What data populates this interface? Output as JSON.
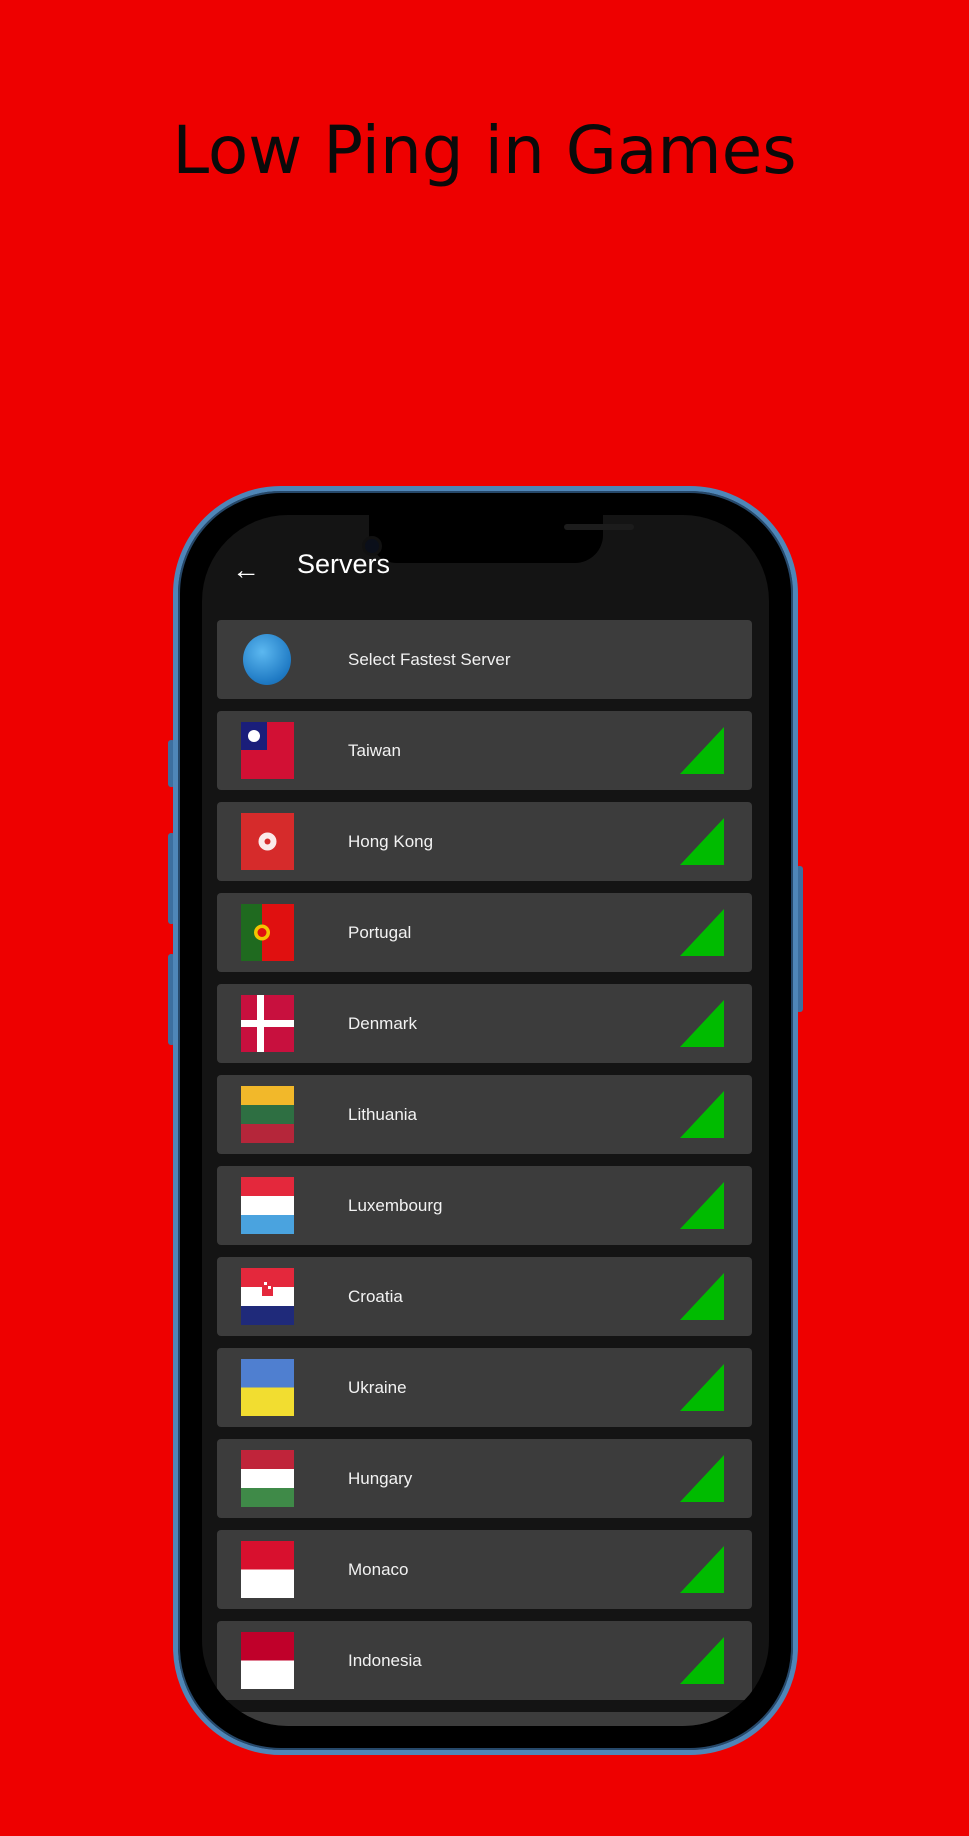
{
  "headline": "Low Ping in Games",
  "screen": {
    "title": "Servers",
    "back_icon": "arrow-left-icon",
    "fastest": {
      "label": "Select Fastest Server",
      "icon": "globe-icon"
    },
    "servers": [
      {
        "name": "Taiwan",
        "flag": "taiwan"
      },
      {
        "name": "Hong Kong",
        "flag": "hongkong"
      },
      {
        "name": "Portugal",
        "flag": "portugal"
      },
      {
        "name": "Denmark",
        "flag": "denmark"
      },
      {
        "name": "Lithuania",
        "flag": "lithuania"
      },
      {
        "name": "Luxembourg",
        "flag": "luxembourg"
      },
      {
        "name": "Croatia",
        "flag": "croatia"
      },
      {
        "name": "Ukraine",
        "flag": "ukraine"
      },
      {
        "name": "Hungary",
        "flag": "hungary"
      },
      {
        "name": "Monaco",
        "flag": "monaco"
      },
      {
        "name": "Indonesia",
        "flag": "indonesia"
      }
    ],
    "signal_color": "#00bb00"
  },
  "colors": {
    "background": "#ee0000",
    "row": "#3c3c3c",
    "frame": "#4f86b8"
  }
}
